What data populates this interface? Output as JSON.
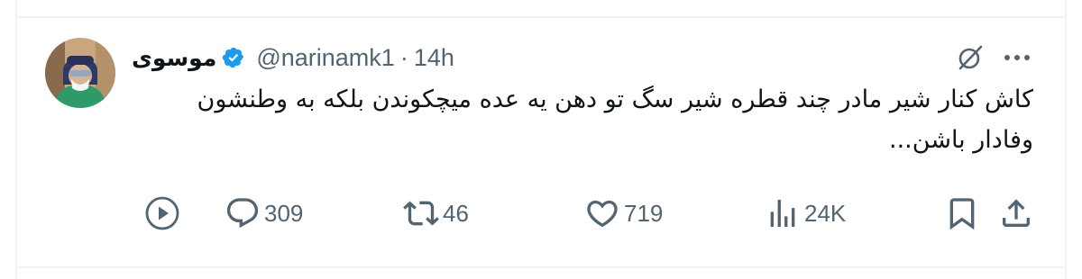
{
  "tweet": {
    "author": {
      "display_name": "موسوی",
      "handle": "@narinamk1",
      "verified": true,
      "avatar_icon": "profile-photo"
    },
    "separator": "·",
    "time": "14h",
    "text_lines": [
      "کاش کنار شیر مادر چند قطره شیر سگ تو دهن یه عده میچکوندن بلکه به وطنشون",
      "وفادار باشن..."
    ],
    "header_icons": [
      "grok-icon",
      "more-icon"
    ],
    "actions": {
      "play_icon": "play-circle-icon",
      "replies": "309",
      "reposts": "46",
      "likes": "719",
      "views": "24K",
      "bookmark_icon": "bookmark-icon",
      "share_icon": "share-icon"
    }
  },
  "colors": {
    "text": "#0f1419",
    "secondary": "#536471",
    "verified": "#1d9bf0",
    "border": "#eff3f4"
  }
}
